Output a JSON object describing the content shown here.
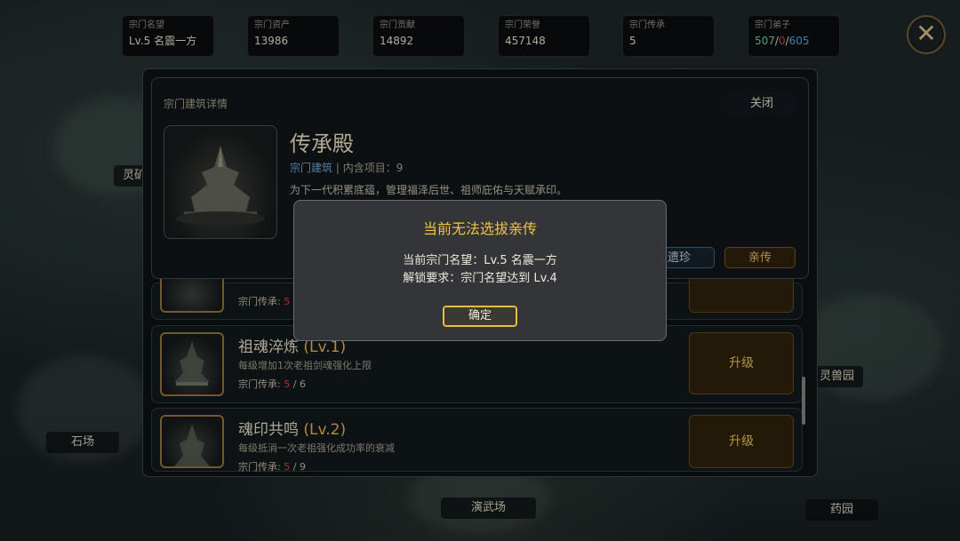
{
  "stats": [
    {
      "label": "宗门名望",
      "value": "Lv.5 名震一方"
    },
    {
      "label": "宗门资产",
      "value": "13986"
    },
    {
      "label": "宗门贡献",
      "value": "14892"
    },
    {
      "label": "宗门荣誉",
      "value": "457148"
    },
    {
      "label": "宗门传承",
      "value": "5"
    },
    {
      "label": "宗门弟子",
      "value_a": "507",
      "sep1": "/",
      "value_b": "0",
      "sep2": "/",
      "value_c": "605"
    }
  ],
  "map_labels": {
    "left_top": "灵矿",
    "left": "石场",
    "right": "灵兽园",
    "bottom": "演武场",
    "bottom_right": "药园"
  },
  "detail": {
    "header": "宗门建筑详情",
    "close": "关闭",
    "name": "传承殿",
    "category": "宗门建筑",
    "sep": "|",
    "items": "内含项目：9",
    "description": "为下一代积累底蕴，管理福泽后世、祖师庇佑与天赋承印。",
    "tab_relic": "遗珍",
    "tab_disciple": "亲传"
  },
  "rows": [
    {
      "progress_label": "宗门传承:",
      "current": "5",
      "max": ""
    },
    {
      "name": "祖魂淬炼",
      "level": "(Lv.1)",
      "desc": "每级增加1次老祖剑魂强化上限",
      "progress_label": "宗门传承:",
      "current": "5",
      "slash": "/",
      "max": "6",
      "button": "升级"
    },
    {
      "name": "魂印共鸣",
      "level": "(Lv.2)",
      "desc": "每级抵消一次老祖强化成功率的衰减",
      "progress_label": "宗门传承:",
      "current": "5",
      "slash": "/",
      "max": "9",
      "button": "升级"
    }
  ],
  "dialog": {
    "title": "当前无法选拔亲传",
    "line1": "当前宗门名望：Lv.5 名震一方",
    "line2": "解锁要求：宗门名望达到 Lv.4",
    "ok": "确定"
  },
  "colors": {
    "accent_gold": "#f0c541",
    "level_gold": "#d9a94a",
    "progress_red": "#c8403a",
    "disciple_green": "#5fc39a",
    "disciple_blue": "#4d9cc9"
  }
}
